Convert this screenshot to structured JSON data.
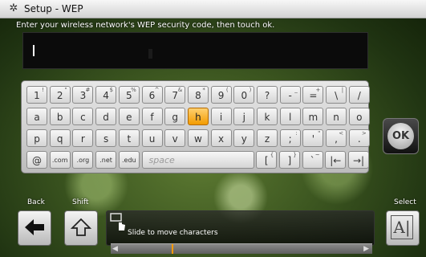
{
  "window": {
    "title": "Setup - WEP",
    "gear_icon": "gear-icon"
  },
  "instructions": "Enter your wireless network's WEP security code, then touch ok.",
  "input": {
    "value": ""
  },
  "keyboard": {
    "rows": [
      [
        {
          "label": "1",
          "sub": "!"
        },
        {
          "label": "2",
          "sub": "\""
        },
        {
          "label": "3",
          "sub": "#"
        },
        {
          "label": "4",
          "sub": "$"
        },
        {
          "label": "5",
          "sub": "%"
        },
        {
          "label": "6",
          "sub": "^"
        },
        {
          "label": "7",
          "sub": "&"
        },
        {
          "label": "8",
          "sub": "*"
        },
        {
          "label": "9",
          "sub": "("
        },
        {
          "label": "0",
          "sub": ")"
        },
        {
          "label": "?",
          "sub": ""
        },
        {
          "label": "-",
          "sub": "_"
        },
        {
          "label": "=",
          "sub": "+"
        },
        {
          "label": "\\",
          "sub": "|"
        },
        {
          "label": "/",
          "sub": ""
        }
      ],
      [
        {
          "label": "a"
        },
        {
          "label": "b"
        },
        {
          "label": "c"
        },
        {
          "label": "d"
        },
        {
          "label": "e"
        },
        {
          "label": "f"
        },
        {
          "label": "g"
        },
        {
          "label": "h",
          "selected": true
        },
        {
          "label": "i"
        },
        {
          "label": "j"
        },
        {
          "label": "k"
        },
        {
          "label": "l"
        },
        {
          "label": "m"
        },
        {
          "label": "n"
        },
        {
          "label": "o"
        }
      ],
      [
        {
          "label": "p"
        },
        {
          "label": "q"
        },
        {
          "label": "r"
        },
        {
          "label": "s"
        },
        {
          "label": "t"
        },
        {
          "label": "u"
        },
        {
          "label": "v"
        },
        {
          "label": "w"
        },
        {
          "label": "x"
        },
        {
          "label": "y"
        },
        {
          "label": "z"
        },
        {
          "label": ";",
          "sub": ":"
        },
        {
          "label": "'",
          "sub": "\""
        },
        {
          "label": ",",
          "sub": "<"
        },
        {
          "label": ".",
          "sub": ">"
        }
      ],
      [
        {
          "label": "@"
        },
        {
          "label": ".com"
        },
        {
          "label": ".org"
        },
        {
          "label": ".net"
        },
        {
          "label": ".edu"
        },
        {
          "label": "space"
        },
        {
          "label": "[",
          "sub": "{"
        },
        {
          "label": "]",
          "sub": "}"
        },
        {
          "label": "`",
          "sub": "~"
        },
        {
          "label": "|←"
        },
        {
          "label": "→|"
        }
      ]
    ]
  },
  "ok_button": {
    "label": "OK"
  },
  "nav": {
    "back_label": "Back",
    "shift_label": "Shift",
    "select_label": "Select"
  },
  "hint": {
    "text": "Slide to move characters"
  }
}
